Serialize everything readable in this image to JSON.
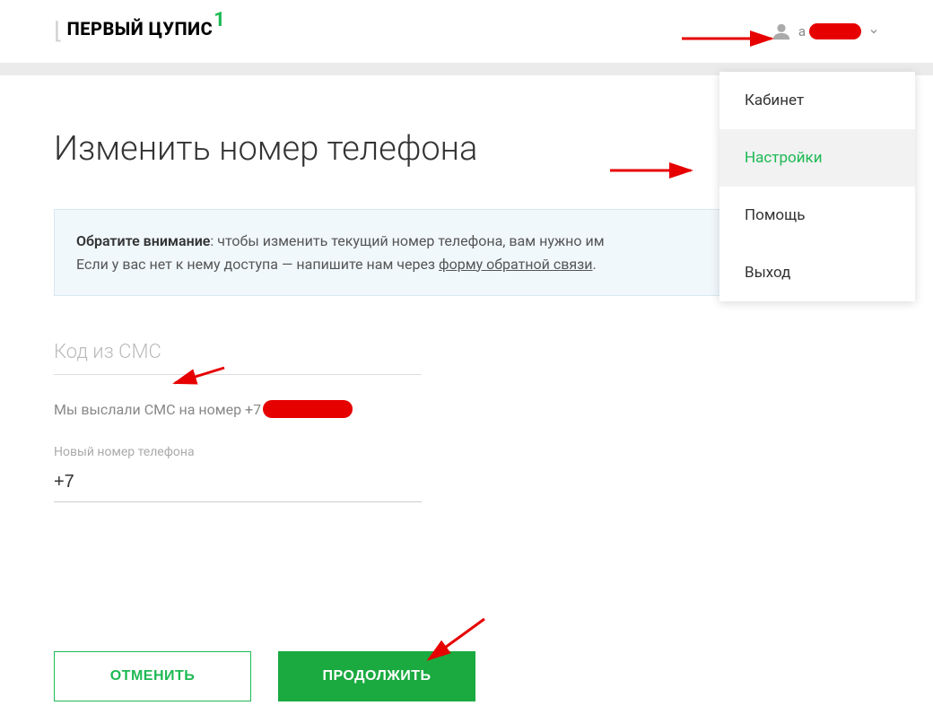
{
  "header": {
    "logo_text": "ПЕРВЫЙ ЦУПИС",
    "logo_sup": "1",
    "user_prefix": "a"
  },
  "dropdown": {
    "items": [
      {
        "label": "Кабинет",
        "active": false
      },
      {
        "label": "Настройки",
        "active": true
      },
      {
        "label": "Помощь",
        "active": false
      },
      {
        "label": "Выход",
        "active": false
      }
    ]
  },
  "page": {
    "title": "Изменить номер телефона"
  },
  "notice": {
    "strong": "Обратите внимание",
    "text1": ": чтобы изменить текущий номер телефона, вам нужно им",
    "text2": "Если у вас нет к нему доступа — напишите нам через ",
    "link": "форму обратной связи",
    "after_link": "."
  },
  "form": {
    "sms_code_label": "Код из СМС",
    "sms_sent_prefix": "Мы выслали СМС на номер +7",
    "new_phone_label": "Новый номер телефона",
    "new_phone_value": "+7"
  },
  "buttons": {
    "cancel": "ОТМЕНИТЬ",
    "continue": "ПРОДОЛЖИТЬ"
  }
}
